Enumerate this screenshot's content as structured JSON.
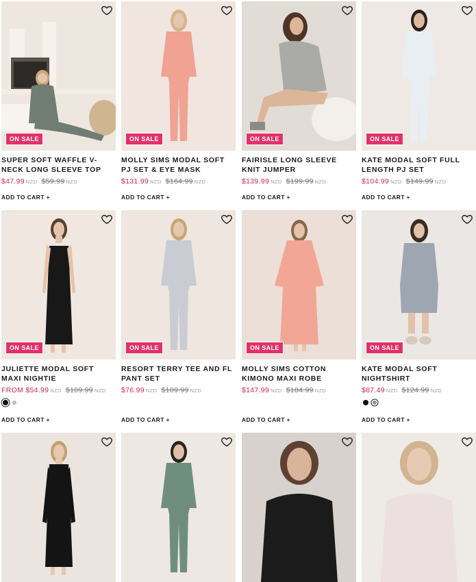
{
  "badge": "ON SALE",
  "currency": "NZD",
  "add_to_cart": "ADD TO CART +",
  "products": [
    {
      "title": "SUPER SOFT WAFFLE V-NECK LONG SLEEVE TOP",
      "price": "$47.99",
      "was": "$59.99",
      "bg": "#ede6df",
      "outfit": "#6f7d73",
      "skin": "#e3c4ad",
      "hair": "#c9a777"
    },
    {
      "title": "MOLLY SIMS MODAL SOFT PJ SET & EYE MASK",
      "price": "$131.99",
      "was": "$164.99",
      "bg": "#f1e5e0",
      "outfit": "#f0a293",
      "skin": "#e6c6ae",
      "hair": "#d4b48c"
    },
    {
      "title": "FAIRISLE LONG SLEEVE KNIT JUMPER",
      "price": "$139.99",
      "was": "$199.99",
      "bg": "#e2dcd6",
      "outfit": "#aaaaa6",
      "skin": "#dcb698",
      "hair": "#4e3426"
    },
    {
      "title": "KATE MODAL SOFT FULL LENGTH PJ SET",
      "price": "$104.99",
      "was": "$149.99",
      "bg": "#efe9e5",
      "outfit": "#e9eef2",
      "skin": "#dcbaa0",
      "hair": "#2a211d"
    },
    {
      "title": "JULIETTE MODAL SOFT MAXI NIGHTIE",
      "price": "FROM $54.99",
      "was": "$109.99",
      "bg": "#f0e7e0",
      "outfit": "#181818",
      "skin": "#e4c4ab",
      "hair": "#5a3f30",
      "swatches": [
        "#111111",
        "#bdbdbd"
      ]
    },
    {
      "title": "RESORT TERRY TEE AND FL PANT SET",
      "price": "$76.99",
      "was": "$109.99",
      "bg": "#eee6df",
      "outfit": "#c9ccd2",
      "skin": "#e6c7ad",
      "hair": "#c7a678"
    },
    {
      "title": "MOLLY SIMS COTTON KIMONO MAXI ROBE",
      "price": "$147.99",
      "was": "$184.99",
      "bg": "#ebdfd8",
      "outfit": "#f2a796",
      "skin": "#e4c3aa",
      "hair": "#8a6a4b"
    },
    {
      "title": "KATE MODAL SOFT NIGHTSHIRT",
      "price": "$87.49",
      "was": "$124.99",
      "bg": "#ebe7e4",
      "outfit": "#9ea6b1",
      "skin": "#e1c2aa",
      "hair": "#3b2b22",
      "swatches": [
        "#111111",
        "#8c96a5"
      ]
    },
    {
      "bg": "#ece5df",
      "outfit": "#141414",
      "skin": "#e6c8b0",
      "hair": "#c4a06f"
    },
    {
      "bg": "#eee8e2",
      "outfit": "#6f8f7c",
      "skin": "#dfbfa5",
      "hair": "#2b2320"
    },
    {
      "bg": "#d7d2cd",
      "outfit": "#1b1b1b",
      "skin": "#d8b49a",
      "hair": "#5d4131"
    },
    {
      "bg": "#eeeae6",
      "outfit": "#ecdfdf",
      "skin": "#e7cab4",
      "hair": "#d1b490"
    }
  ]
}
